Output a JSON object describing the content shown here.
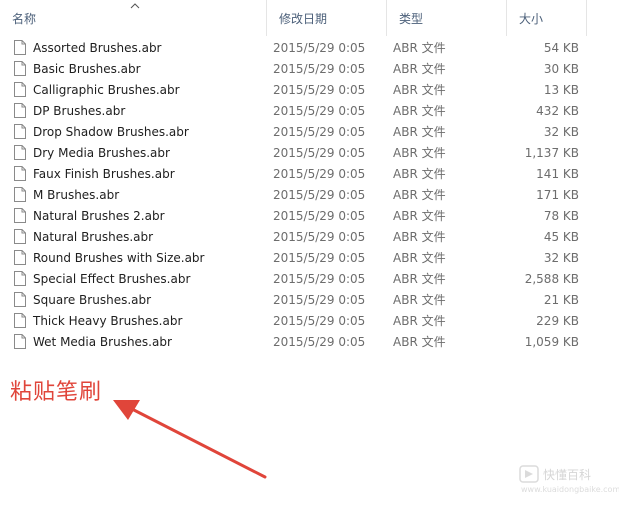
{
  "columns": {
    "name": "名称",
    "date": "修改日期",
    "type": "类型",
    "size": "大小"
  },
  "files": [
    {
      "name": "Assorted Brushes.abr",
      "date": "2015/5/29 0:05",
      "type": "ABR 文件",
      "size": "54 KB"
    },
    {
      "name": "Basic Brushes.abr",
      "date": "2015/5/29 0:05",
      "type": "ABR 文件",
      "size": "30 KB"
    },
    {
      "name": "Calligraphic Brushes.abr",
      "date": "2015/5/29 0:05",
      "type": "ABR 文件",
      "size": "13 KB"
    },
    {
      "name": "DP Brushes.abr",
      "date": "2015/5/29 0:05",
      "type": "ABR 文件",
      "size": "432 KB"
    },
    {
      "name": "Drop Shadow Brushes.abr",
      "date": "2015/5/29 0:05",
      "type": "ABR 文件",
      "size": "32 KB"
    },
    {
      "name": "Dry Media Brushes.abr",
      "date": "2015/5/29 0:05",
      "type": "ABR 文件",
      "size": "1,137 KB"
    },
    {
      "name": "Faux Finish Brushes.abr",
      "date": "2015/5/29 0:05",
      "type": "ABR 文件",
      "size": "141 KB"
    },
    {
      "name": "M Brushes.abr",
      "date": "2015/5/29 0:05",
      "type": "ABR 文件",
      "size": "171 KB"
    },
    {
      "name": "Natural Brushes 2.abr",
      "date": "2015/5/29 0:05",
      "type": "ABR 文件",
      "size": "78 KB"
    },
    {
      "name": "Natural Brushes.abr",
      "date": "2015/5/29 0:05",
      "type": "ABR 文件",
      "size": "45 KB"
    },
    {
      "name": "Round Brushes with Size.abr",
      "date": "2015/5/29 0:05",
      "type": "ABR 文件",
      "size": "32 KB"
    },
    {
      "name": "Special Effect Brushes.abr",
      "date": "2015/5/29 0:05",
      "type": "ABR 文件",
      "size": "2,588 KB"
    },
    {
      "name": "Square Brushes.abr",
      "date": "2015/5/29 0:05",
      "type": "ABR 文件",
      "size": "21 KB"
    },
    {
      "name": "Thick Heavy Brushes.abr",
      "date": "2015/5/29 0:05",
      "type": "ABR 文件",
      "size": "229 KB"
    },
    {
      "name": "Wet Media Brushes.abr",
      "date": "2015/5/29 0:05",
      "type": "ABR 文件",
      "size": "1,059 KB"
    }
  ],
  "annotation": {
    "text": "粘贴笔刷",
    "color": "#e0453a"
  },
  "watermark": {
    "text": "快懂百科",
    "sub": "www.kuaidongbaike.com"
  },
  "icons": {
    "sort": "chevron-up-icon",
    "file": "file-icon"
  }
}
